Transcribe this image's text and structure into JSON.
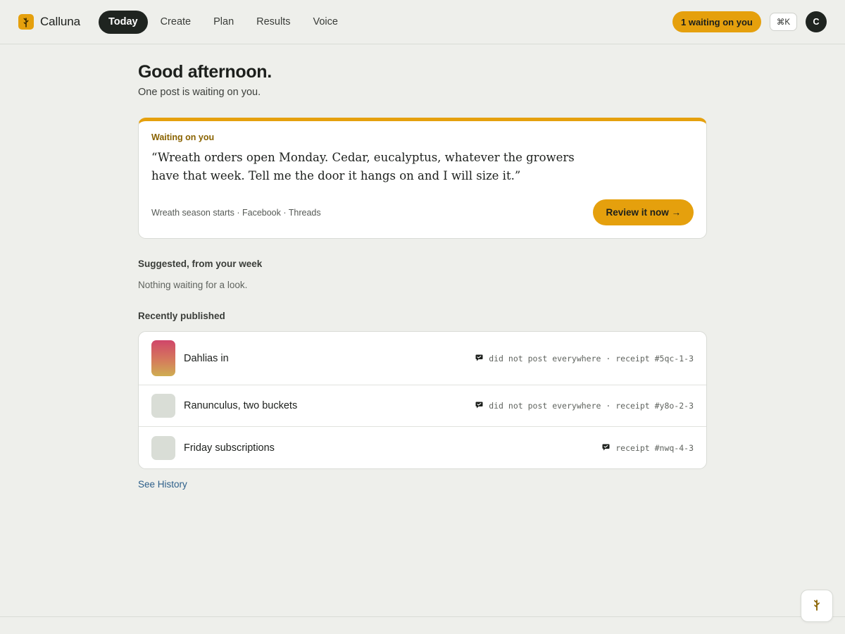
{
  "brand": {
    "name": "Calluna",
    "icon": "sprig-icon",
    "accent": "#e5a00d"
  },
  "nav": {
    "items": [
      {
        "label": "Today",
        "active": true
      },
      {
        "label": "Create",
        "active": false
      },
      {
        "label": "Plan",
        "active": false
      },
      {
        "label": "Results",
        "active": false
      },
      {
        "label": "Voice",
        "active": false
      }
    ]
  },
  "header": {
    "waiting_pill": "1 waiting on you",
    "shortcut": "⌘K",
    "avatar_initial": "C"
  },
  "main": {
    "greeting": "Good afternoon.",
    "subtitle": "One post is waiting on you."
  },
  "waiting_card": {
    "label": "Waiting on you",
    "quote": "“Wreath orders open Monday. Cedar, eucalyptus, whatever the growers have that week. Tell me the door it hangs on and I will size it.”",
    "meta": "Wreath season starts · Facebook · Threads",
    "button": "Review it now →"
  },
  "suggested": {
    "title": "Suggested, from your week",
    "empty": "Nothing waiting for a look."
  },
  "published": {
    "title": "Recently published",
    "rows": [
      {
        "title": "Dahlias in",
        "meta": "did not post everywhere · receipt #5qc-1-3",
        "icon": "chat-icon"
      },
      {
        "title": "Ranunculus, two buckets",
        "meta": "did not post everywhere · receipt #y8o-2-3",
        "icon": "chat-icon"
      },
      {
        "title": "Friday subscriptions",
        "meta": "receipt #nwq-4-3",
        "icon": "chat-icon"
      }
    ],
    "see_history": "See History"
  },
  "fab": {
    "icon": "sprig-icon"
  },
  "colors": {
    "background": "#eeefeb",
    "accent": "#e5a00d",
    "dark": "#1f2420",
    "link": "#2d5f8a"
  }
}
